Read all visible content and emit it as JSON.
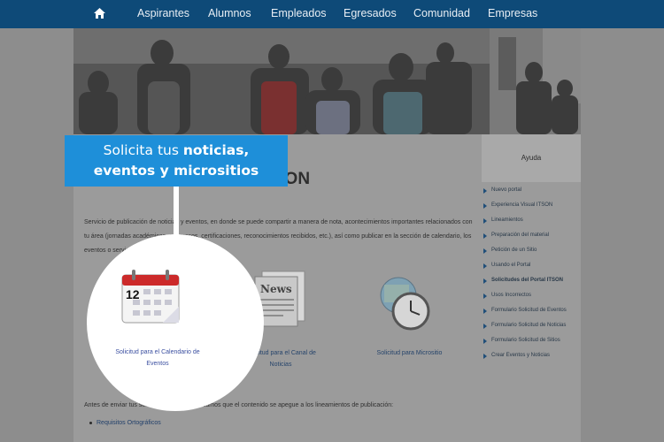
{
  "nav": {
    "items": [
      "Aspirantes",
      "Alumnos",
      "Empleados",
      "Egresados",
      "Comunidad",
      "Empresas"
    ]
  },
  "page": {
    "title_visible": "ITSON",
    "description": "Servicio de publicación de noticias y eventos, en donde se puede compartir a manera de nota, acontecimientos importantes relacionados con tu área (jornadas académicas, congresos, certificaciones, reconocimientos recibidos, etc.), así como publicar en la sección de calendario, los eventos o servicios que el área ofrece.",
    "services": [
      {
        "label_line1": "Solicitud para el Calendario de",
        "label_line2": "Eventos",
        "icon": "calendar-icon",
        "date": "12"
      },
      {
        "label_line1": "Solicitud para el Canal de",
        "label_line2": "Noticias",
        "icon": "newspaper-icon",
        "paper_text": "News"
      },
      {
        "label_line1": "Solicitud para Micrositio",
        "label_line2": "",
        "icon": "globe-clock-icon"
      }
    ],
    "note": "Antes de enviar tus solicitudes, te recomendamos que el contenido se apegue a los lineamientos de publicación:",
    "bullets": [
      "Requisitos Ortográficos"
    ]
  },
  "sidebar": {
    "title": "Ayuda",
    "links": [
      "Nuevo portal",
      "Experiencia Visual ITSON",
      "Lineamientos",
      "Preparación del material",
      "Petición de un Sitio",
      "Usando el Portal",
      "Solicitudes del Portal ITSON",
      "Usos Incorrectos",
      "Formulario Solicitud de Eventos",
      "Formulario Solicitud de Noticias",
      "Formulario Solicitud de Sitios",
      "Crear Eventos y Noticias"
    ]
  },
  "callout": {
    "pre": "Solicita tus ",
    "bold1": "noticias,",
    "bold2": "eventos y micrositios"
  },
  "colors": {
    "nav": "#0e4a78",
    "callout": "#1e8fd9",
    "link": "#26446b"
  }
}
